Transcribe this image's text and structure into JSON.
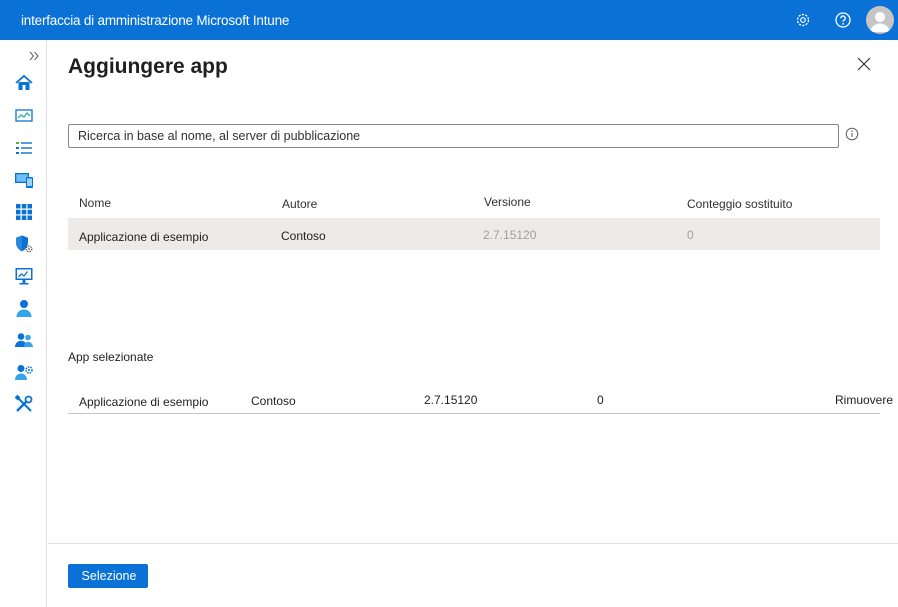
{
  "header": {
    "title": "interfaccia di amministrazione Microsoft Intune",
    "icons": [
      "gear-icon",
      "help-icon",
      "avatar"
    ]
  },
  "sidebar": {
    "icons": [
      "expand-icon",
      "home-icon",
      "dashboard-icon",
      "all-services-icon",
      "devices-icon",
      "apps-icon",
      "endpoint-security-icon",
      "reports-icon",
      "users-icon",
      "groups-icon",
      "tenant-admin-icon",
      "troubleshooting-icon"
    ]
  },
  "panel": {
    "title": "Aggiungere app",
    "search": {
      "placeholder": "Ricerca in base al nome, al server di pubblicazione",
      "value": ""
    },
    "columns": [
      "Nome",
      "Autore",
      "Versione",
      "Conteggio sostituito"
    ],
    "rows": [
      {
        "name": "Applicazione di esempio",
        "author": "Contoso",
        "version": "2.7.15120",
        "count": "0"
      }
    ],
    "selected_label": "App selezionate",
    "selected_rows": [
      {
        "name": "Applicazione di esempio",
        "author": "Contoso",
        "version": "2.7.15120",
        "count": "0",
        "action": "Rimuovere"
      }
    ],
    "select_button": "Selezione"
  },
  "colors": {
    "accent": "#0a72d6",
    "row_hover": "#edebe9",
    "dim_text": "#a19f9d"
  }
}
